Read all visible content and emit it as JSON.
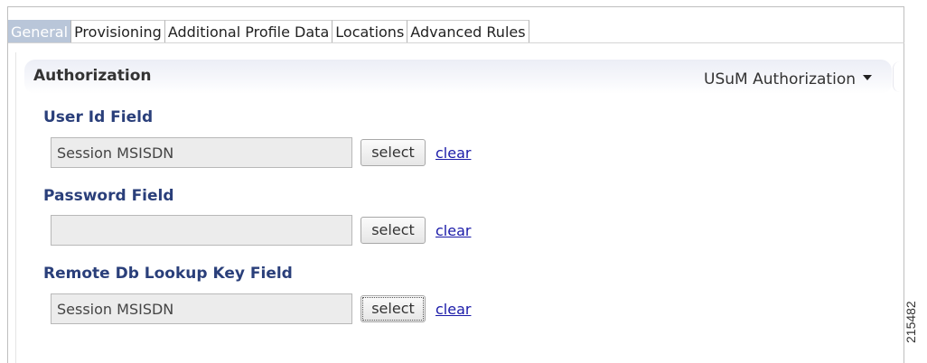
{
  "tabs": [
    {
      "label": "General",
      "active": true
    },
    {
      "label": "Provisioning",
      "active": false
    },
    {
      "label": "Additional Profile Data",
      "active": false
    },
    {
      "label": "Locations",
      "active": false
    },
    {
      "label": "Advanced Rules",
      "active": false
    }
  ],
  "section": {
    "title": "Authorization",
    "dropdown_value": "USuM Authorization"
  },
  "fields": [
    {
      "label": "User Id Field",
      "value": "Session MSISDN",
      "select_label": "select",
      "clear_label": "clear"
    },
    {
      "label": "Password Field",
      "value": "",
      "select_label": "select",
      "clear_label": "clear"
    },
    {
      "label": "Remote Db Lookup Key Field",
      "value": "Session MSISDN",
      "select_label": "select",
      "clear_label": "clear"
    }
  ],
  "figure_number": "215482",
  "colors": {
    "active_tab_bg": "#b9c6d9",
    "field_label": "#2a3f7a",
    "link": "#1a1aa8"
  }
}
